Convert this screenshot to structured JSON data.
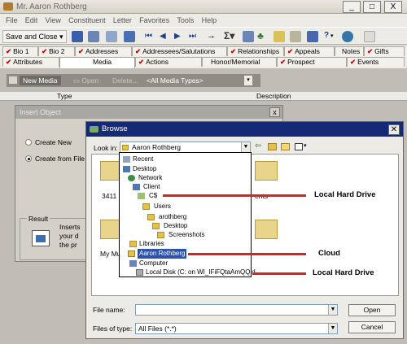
{
  "window": {
    "title": "Mr. Aaron Rothberg",
    "controls": [
      "_",
      "□",
      "X"
    ]
  },
  "menu": [
    "File",
    "Edit",
    "View",
    "Constituent",
    "Letter",
    "Favorites",
    "Tools",
    "Help"
  ],
  "toolbar": {
    "save_close": "Save and Close",
    "help_glyph": "?"
  },
  "tabs_row1": [
    "Bio 1",
    "Bio 2",
    "Addresses",
    "Addressees/Salutations",
    "Relationships",
    "Appeals",
    "Notes",
    "Gifts"
  ],
  "tabs_row2": [
    "Attributes",
    "Media",
    "Actions",
    "Honor/Memorial",
    "Prospect",
    "Events"
  ],
  "media_bar": {
    "new_media": "New Media",
    "open": "Open",
    "delete": "Delete...",
    "filter": "<All Media Types>"
  },
  "columns": {
    "type": "Type",
    "description": "Description"
  },
  "insert_object": {
    "title": "Insert Object",
    "create_new": "Create New",
    "create_from_file": "Create from File",
    "result": "Result",
    "result_text": [
      "Inserts",
      "your d",
      "the pr"
    ]
  },
  "browse": {
    "title": "Browse",
    "look_in_label": "Look in:",
    "look_in_value": "Aaron Rothberg",
    "file_name_label": "File name:",
    "file_name_value": "",
    "files_of_type_label": "Files of type:",
    "files_of_type_value": "All Files (*.*)",
    "open": "Open",
    "cancel": "Cancel",
    "background_labels": [
      "3411",
      "My Mu",
      "ents"
    ],
    "dropdown_items": [
      "Recent",
      "Desktop",
      "Network",
      "Client",
      "C$",
      "Users",
      "arothberg",
      "Desktop",
      "Screenshots",
      "Libraries",
      "Aaron Rothberg",
      "Computer",
      "Local Disk (C: on WI_IFiFQtaAmQQld"
    ]
  },
  "annotations": [
    "Local Hard Drive",
    "Cloud",
    "Local Hard Drive"
  ]
}
